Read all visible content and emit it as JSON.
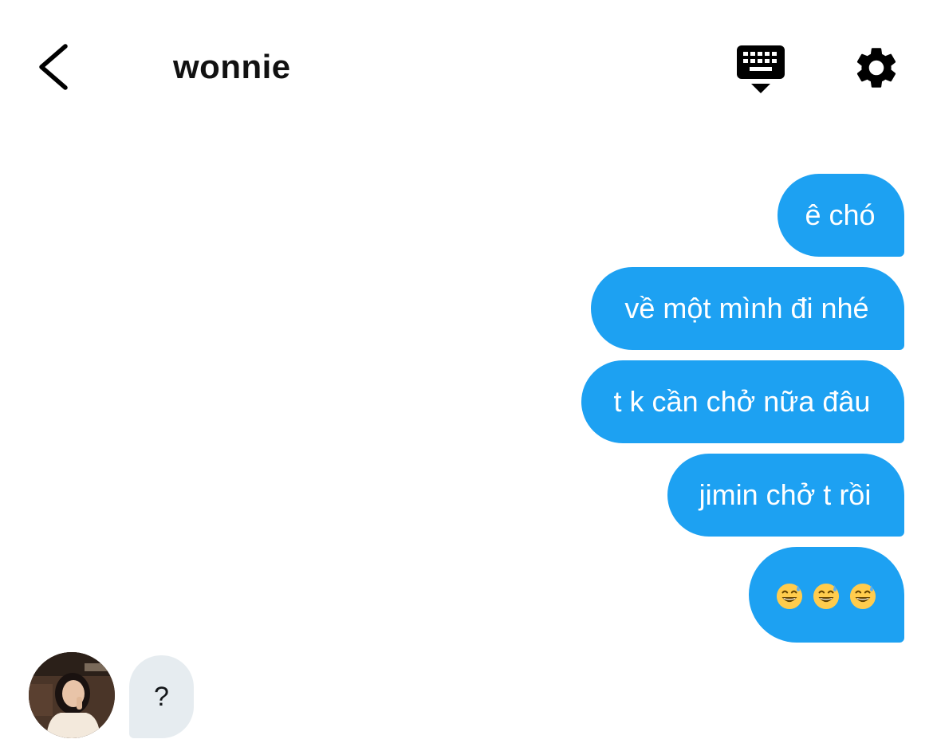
{
  "header": {
    "title": "wonnie",
    "icons": {
      "back": "chevron-left-icon",
      "keyboard": "keyboard-hide-icon",
      "settings": "gear-icon"
    }
  },
  "messages": {
    "sent": [
      {
        "text": "ê chó"
      },
      {
        "text": "về một mình đi nhé"
      },
      {
        "text": "t k cần chở nữa đâu"
      },
      {
        "text": "jimin chở t rồi"
      },
      {
        "emoji": [
          "grinning-sweat-emoji",
          "grinning-sweat-emoji",
          "grinning-sweat-emoji"
        ]
      }
    ],
    "received": [
      {
        "text": "?"
      }
    ]
  },
  "colors": {
    "sent_bubble": "#1da1f2",
    "received_bubble": "#e6ecf0",
    "background": "#ffffff",
    "icon": "#000000"
  }
}
